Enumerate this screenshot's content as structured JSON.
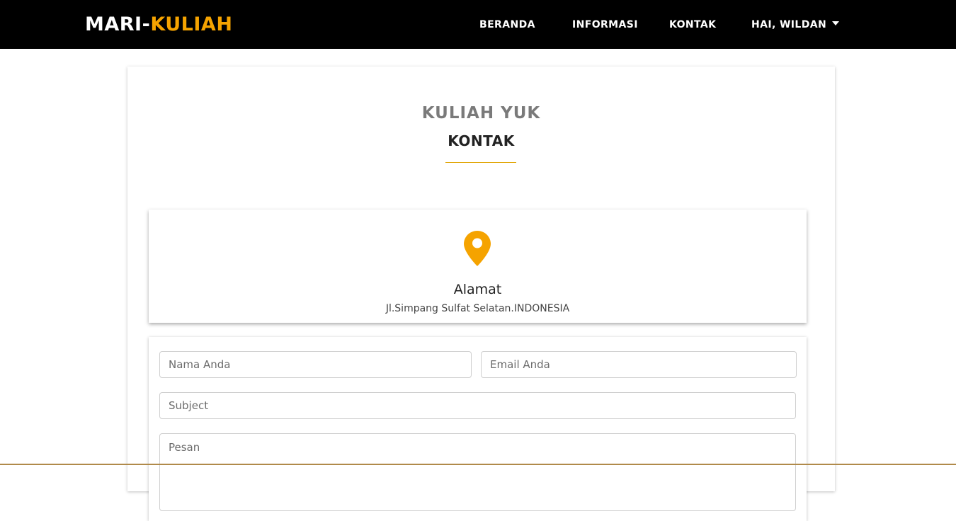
{
  "navbar": {
    "logo_part1": "MARI-",
    "logo_part2": "KULIAH",
    "links": [
      {
        "label": "BERANDA"
      },
      {
        "label": "INFORMASI"
      },
      {
        "label": "KONTAK"
      }
    ],
    "user_menu": {
      "label": "HAI, WILDAN",
      "icon": "caret-down-icon"
    }
  },
  "header": {
    "title": "KULIAH YUK",
    "subtitle": "KONTAK",
    "accent_color": "#e0a400"
  },
  "address": {
    "icon": "map-pin-icon",
    "icon_color": "#f5a300",
    "title": "Alamat",
    "text": "Jl.Simpang Sulfat Selatan.INDONESIA"
  },
  "form": {
    "name_placeholder": "Nama Anda",
    "email_placeholder": "Email Anda",
    "subject_placeholder": "Subject",
    "message_placeholder": "Pesan"
  }
}
